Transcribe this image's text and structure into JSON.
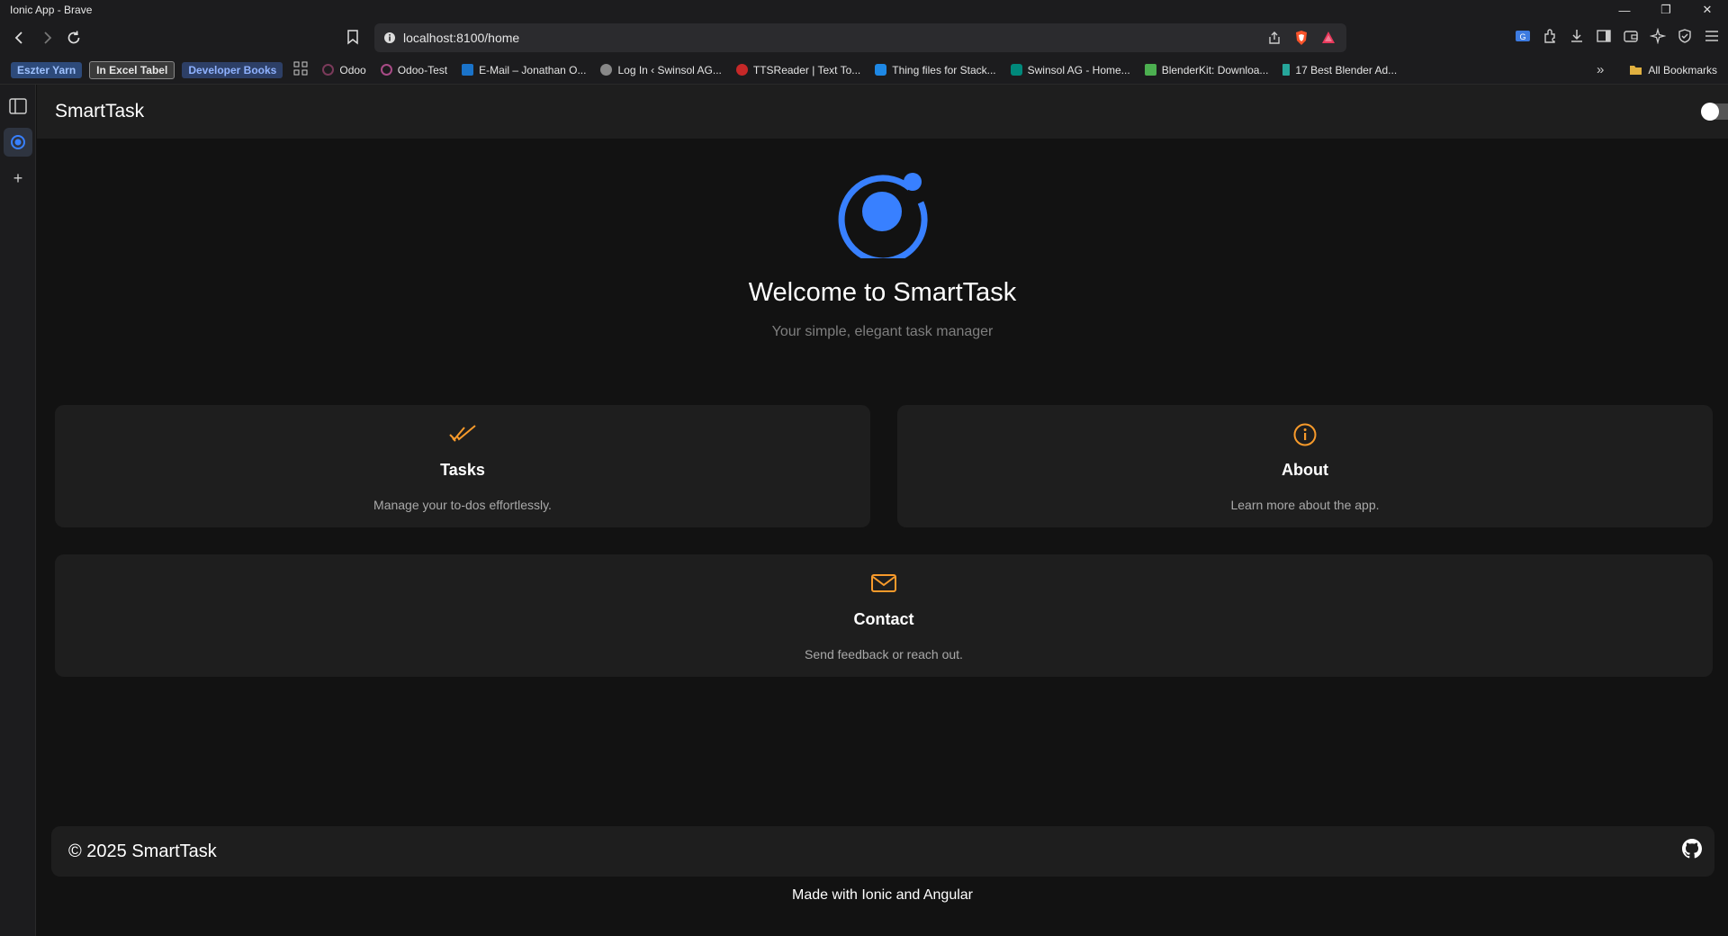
{
  "window": {
    "title": "Ionic App - Brave"
  },
  "browser": {
    "url": "localhost:8100/home",
    "bookmarks_tags": [
      {
        "label": "Eszter Yarn",
        "bg": "#2d4a7a",
        "fg": "#9fc2ff"
      },
      {
        "label": "In Excel Tabel",
        "bg": "#3a3a3a",
        "fg": "#e6e6e6"
      },
      {
        "label": "Developer Books",
        "bg": "#2d3f66",
        "fg": "#8fb2ff"
      }
    ],
    "bookmarks": [
      {
        "label": "Odoo",
        "color": "#7a3a5a"
      },
      {
        "label": "Odoo-Test",
        "color": "#a84b86"
      },
      {
        "label": "E-Mail – Jonathan O...",
        "color": "#1a73c9"
      },
      {
        "label": "Log In ‹ Swinsol AG...",
        "color": "#888888"
      },
      {
        "label": "TTSReader | Text To...",
        "color": "#c62828"
      },
      {
        "label": "Thing files for Stack...",
        "color": "#1e88e5"
      },
      {
        "label": "Swinsol AG - Home...",
        "color": "#00897b"
      },
      {
        "label": "BlenderKit: Downloa...",
        "color": "#4caf50"
      },
      {
        "label": "17 Best Blender Ad...",
        "color": "#26a69a"
      }
    ],
    "all_bookmarks": "All Bookmarks"
  },
  "app": {
    "brand": "SmartTask",
    "welcome": "Welcome to SmartTask",
    "subtitle": "Your simple, elegant task manager",
    "accent": "#f79a2b",
    "logo_color": "#3880ff",
    "cards": [
      {
        "icon": "checkmark-done-icon",
        "title": "Tasks",
        "desc": "Manage your to-dos effortlessly."
      },
      {
        "icon": "info-icon",
        "title": "About",
        "desc": "Learn more about the app."
      },
      {
        "icon": "mail-icon",
        "title": "Contact",
        "desc": "Send feedback or reach out."
      }
    ],
    "footer": "© 2025 SmartTask",
    "made_with": "Made with Ionic and Angular"
  }
}
